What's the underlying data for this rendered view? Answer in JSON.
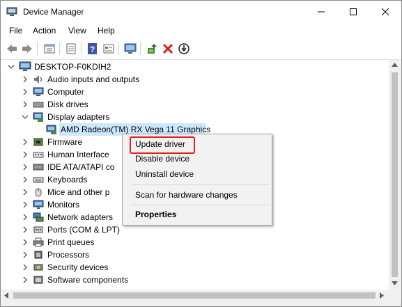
{
  "window": {
    "title": "Device Manager",
    "app_icon": "device-manager-icon"
  },
  "controls": {
    "minimize": "minimize-icon",
    "maximize": "maximize-icon",
    "close": "close-icon"
  },
  "menu": [
    "File",
    "Action",
    "View",
    "Help"
  ],
  "toolbar": [
    "back-arrow-icon",
    "forward-arrow-icon",
    "properties-icon",
    "show-hidden-icon",
    "help-icon",
    "view-icon",
    "monitor-icon",
    "update-driver-icon",
    "uninstall-x-icon",
    "scan-download-icon"
  ],
  "tree": {
    "root": "DESKTOP-F0KDIH2",
    "items": [
      "Audio inputs and outputs",
      "Computer",
      "Disk drives",
      "Display adapters",
      "AMD Radeon(TM) RX Vega 11 Graphics",
      "Firmware",
      "Human Interface",
      "IDE ATA/ATAPI co",
      "Keyboards",
      "Mice and other p",
      "Monitors",
      "Network adapters",
      "Ports (COM & LPT)",
      "Print queues",
      "Processors",
      "Security devices",
      "Software components"
    ]
  },
  "context_menu": {
    "update": "Update driver",
    "disable": "Disable device",
    "uninstall": "Uninstall device",
    "scan": "Scan for hardware changes",
    "properties": "Properties"
  },
  "colors": {
    "selection": "#cce8ff",
    "highlight_border": "#e0201c",
    "menu_bg": "#f2f2f2"
  }
}
